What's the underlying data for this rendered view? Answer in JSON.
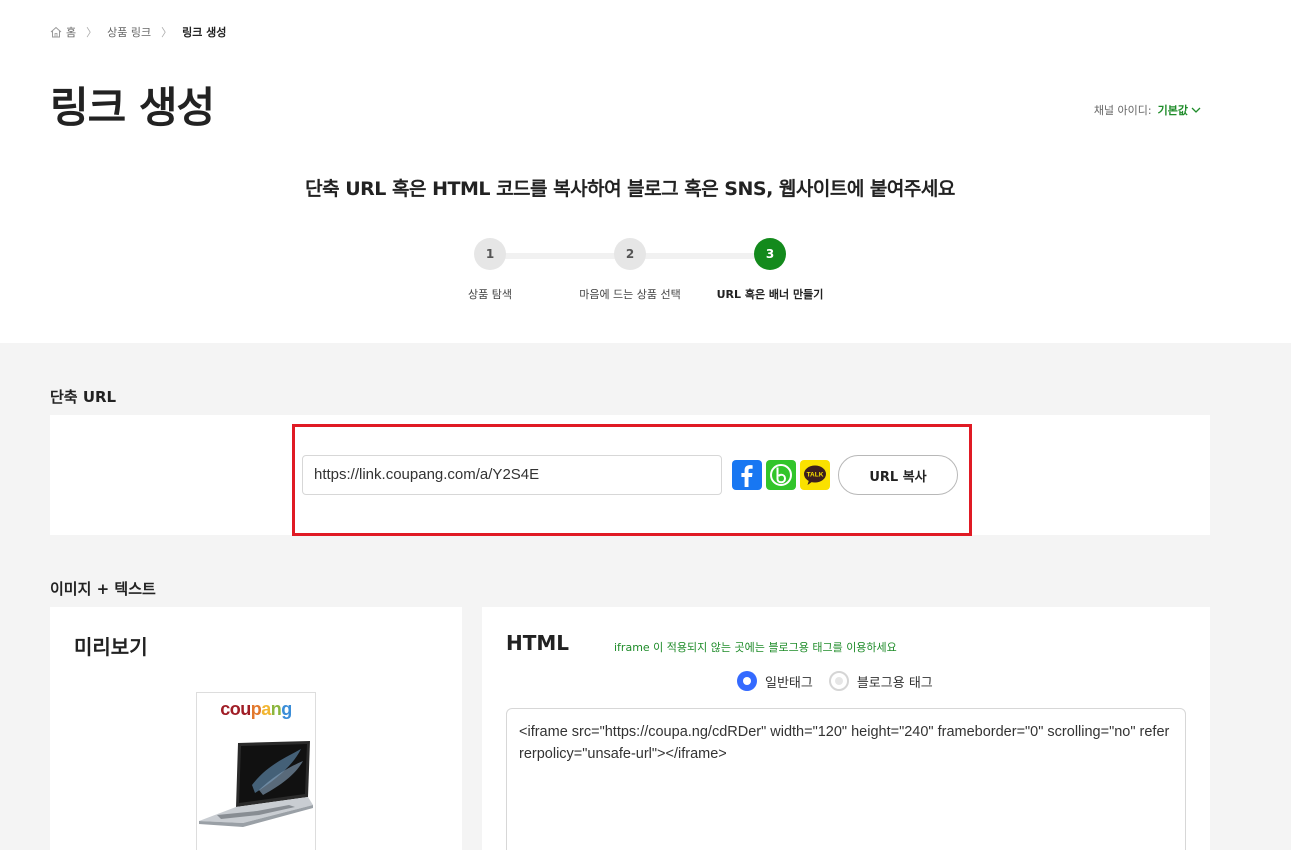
{
  "breadcrumb": {
    "home": "홈",
    "level2": "상품 링크",
    "current": "링크 생성"
  },
  "page": {
    "title": "링크 생성",
    "channel_label": "채널 아이디:",
    "channel_value": "기본값",
    "subtitle": "단축 URL 혹은 HTML 코드를 복사하여 블로그 혹은 SNS, 웹사이트에 붙여주세요"
  },
  "steps": [
    {
      "number": "1",
      "label": "상품 탐색"
    },
    {
      "number": "2",
      "label": "마음에 드는 상품 선택"
    },
    {
      "number": "3",
      "label": "URL 혹은 배너 만들기"
    }
  ],
  "active_step": 3,
  "short_url": {
    "section_title": "단축 URL",
    "value": "https://link.coupang.com/a/Y2S4E",
    "share_icons": [
      "facebook-icon",
      "band-icon",
      "kakaotalk-icon"
    ],
    "kakao_text": "TALK",
    "copy_label": "URL 복사"
  },
  "image_text": {
    "section_title": "이미지 + 텍스트",
    "preview_title": "미리보기",
    "banner_logo": "coupang",
    "html_title": "HTML",
    "note": "iframe 이 적용되지 않는 곳에는 블로그용 태그를 이용하세요",
    "radio_options": [
      {
        "label": "일반태그",
        "selected": true
      },
      {
        "label": "블로그용 태그",
        "selected": false
      }
    ],
    "code": "<iframe src=\"https://coupa.ng/cdRDer\" width=\"120\" height=\"240\" frameborder=\"0\" scrolling=\"no\" referrerpolicy=\"unsafe-url\"></iframe>"
  },
  "colors": {
    "accent_green": "#138a1c",
    "highlight_red": "#e01a24",
    "radio_blue": "#346aff",
    "facebook": "#1877f2",
    "band": "#32c52a",
    "kakao": "#fae100"
  }
}
